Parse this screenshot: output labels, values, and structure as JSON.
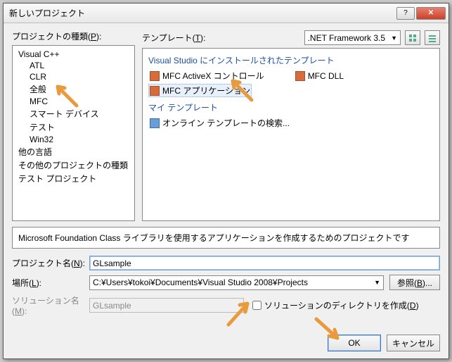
{
  "title": "新しいプロジェクト",
  "labels": {
    "project_types": "プロジェクトの種類(",
    "project_types_u": "P",
    "project_types_after": "):",
    "templates": "テンプレート(",
    "templates_u": "T",
    "templates_after": "):",
    "framework": ".NET Framework 3.5",
    "desc": "Microsoft Foundation Class ライブラリを使用するアプリケーションを作成するためのプロジェクトです",
    "name": "プロジェクト名(",
    "name_u": "N",
    "name_after": "):",
    "location": "場所(",
    "location_u": "L",
    "location_after": "):",
    "solution": "ソリューション名(",
    "solution_u": "M",
    "solution_after": "):",
    "browse": "参照(",
    "browse_u": "B",
    "browse_after": ")...",
    "create_dir": "ソリューションのディレクトリを作成(",
    "create_dir_u": "D",
    "create_dir_after": ")",
    "ok": "OK",
    "cancel": "キャンセル"
  },
  "tree": {
    "visual_cpp": "Visual C++",
    "atl": "ATL",
    "clr": "CLR",
    "general": "全般",
    "mfc": "MFC",
    "smart": "スマート デバイス",
    "test": "テスト",
    "win32": "Win32",
    "other_lang": "他の言語",
    "other_proj": "その他のプロジェクトの種類",
    "test_proj": "テスト プロジェクト"
  },
  "templates": {
    "installed": "Visual Studio にインストールされたテンプレート",
    "my": "マイ テンプレート",
    "mfc_activex": "MFC ActiveX コントロール",
    "mfc_dll": "MFC DLL",
    "mfc_app": "MFC アプリケーション",
    "online": "オンライン テンプレートの検索..."
  },
  "values": {
    "name": "GLsample",
    "location": "C:¥Users¥tokoi¥Documents¥Visual Studio 2008¥Projects",
    "solution": "GLsample",
    "create_dir_checked": false
  },
  "colors": {
    "accent": "#1a4f9c",
    "arrow": "#e89a3c"
  }
}
